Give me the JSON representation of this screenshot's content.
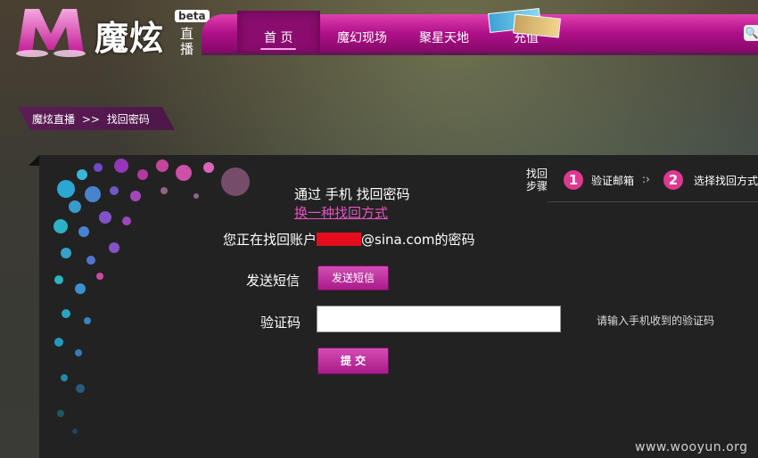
{
  "brand": {
    "name": "魔炫",
    "sub": "直播",
    "beta": "beta"
  },
  "nav": {
    "items": [
      "首 页",
      "魔幻现场",
      "聚星天地",
      "充值"
    ],
    "active": "首 页"
  },
  "breadcrumb": {
    "home": "魔炫直播",
    "separator": ">>",
    "current": "找回密码"
  },
  "steps": {
    "label": "找回步骤",
    "items": [
      {
        "num": "1",
        "text": "验证邮箱"
      },
      {
        "num": "2",
        "text": "选择找回方式"
      }
    ],
    "arrow": ":›"
  },
  "form": {
    "title": "通过 手机 找回密码",
    "switch_link": "换一种找回方式",
    "account_prefix": "您正在找回账户",
    "account_suffix": "@sina.com的密码",
    "sms_label": "发送短信",
    "sms_button": "发送短信",
    "code_label": "验证码",
    "code_value": "",
    "code_hint": "请输入手机收到的验证码",
    "submit_button": "提 交"
  },
  "watermark": "www.wooyun.org",
  "colors": {
    "accent": "#e0388f",
    "nav": "#b0108a",
    "link": "#e455bd",
    "redaction": "#e50d1d"
  }
}
